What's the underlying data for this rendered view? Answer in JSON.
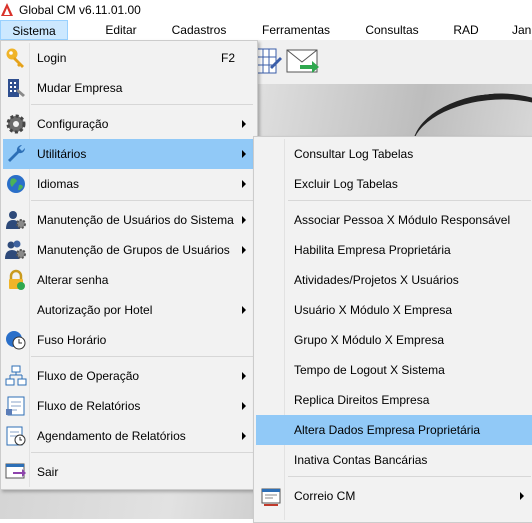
{
  "window": {
    "title": "Global CM v6.11.01.00"
  },
  "menubar": [
    {
      "label": "Sistema",
      "active": true
    },
    {
      "label": "Editar"
    },
    {
      "label": "Cadastros"
    },
    {
      "label": "Ferramentas"
    },
    {
      "label": "Consultas"
    },
    {
      "label": "RAD"
    },
    {
      "label": "Jan"
    }
  ],
  "sistema_menu": [
    {
      "label": "Login",
      "shortcut": "F2",
      "icon": "key-icon"
    },
    {
      "label": "Mudar Empresa",
      "icon": "building-icon"
    },
    {
      "label": "Configuração",
      "icon": "gear-icon",
      "submenu": true
    },
    {
      "label": "Utilitários",
      "icon": "wrench-icon",
      "submenu": true,
      "selected": true
    },
    {
      "label": "Idiomas",
      "icon": "globe-icon",
      "submenu": true
    },
    {
      "label": "Manutenção de Usuários do Sistema",
      "icon": "user-gear-icon",
      "submenu": true
    },
    {
      "label": "Manutenção de Grupos de Usuários",
      "icon": "users-gear-icon",
      "submenu": true
    },
    {
      "label": "Alterar senha",
      "icon": "lock-icon"
    },
    {
      "label": "Autorização por Hotel",
      "submenu": true
    },
    {
      "label": "Fuso Horário",
      "icon": "clock-globe-icon"
    },
    {
      "label": "Fluxo de Operação",
      "icon": "flowchart-icon",
      "submenu": true
    },
    {
      "label": "Fluxo de Relatórios",
      "icon": "report-flow-icon",
      "submenu": true
    },
    {
      "label": "Agendamento de Relatórios",
      "icon": "report-schedule-icon",
      "submenu": true
    },
    {
      "label": "Sair",
      "icon": "exit-icon"
    }
  ],
  "utilitarios_menu": [
    {
      "label": "Consultar Log Tabelas"
    },
    {
      "label": "Excluir Log Tabelas"
    },
    {
      "label": "Associar Pessoa X Módulo Responsável"
    },
    {
      "label": "Habilita Empresa Proprietária"
    },
    {
      "label": "Atividades/Projetos X Usuários"
    },
    {
      "label": "Usuário X Módulo X Empresa"
    },
    {
      "label": "Grupo X Módulo X Empresa"
    },
    {
      "label": "Tempo de Logout X Sistema"
    },
    {
      "label": "Replica Direitos Empresa"
    },
    {
      "label": "Altera Dados Empresa Proprietária",
      "selected": true
    },
    {
      "label": "Inativa Contas Bancárias"
    },
    {
      "label": "Correio CM",
      "icon": "mail-window-icon",
      "submenu": true
    }
  ],
  "colors": {
    "menu_bg": "#f2f2f2",
    "selection": "#91c9f7",
    "menubar_active": "#cce8ff"
  }
}
